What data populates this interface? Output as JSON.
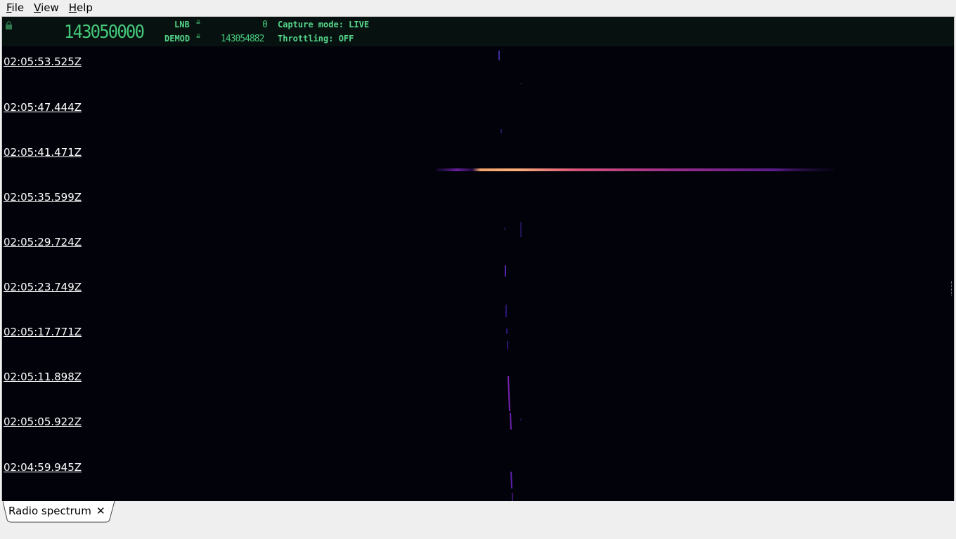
{
  "menubar": {
    "file": {
      "mnemonic": "F",
      "rest": "ile"
    },
    "view": {
      "mnemonic": "V",
      "rest": "iew"
    },
    "help": {
      "mnemonic": "H",
      "rest": "elp"
    }
  },
  "status": {
    "center_frequency": "143050000",
    "lnb_label": "LNB",
    "lnb_value": "0",
    "demod_label": "DEMOD",
    "demod_value": "143054882",
    "capture_mode": "Capture mode: LIVE",
    "throttling": "Throttling: OFF",
    "text_color": "#4ecf80",
    "background_color": "#061110"
  },
  "waterfall": {
    "colormap": "magma",
    "background_color": "#02030a",
    "timestamps": [
      "02:05:53.525Z",
      "02:05:47.444Z",
      "02:05:41.471Z",
      "02:05:35.599Z",
      "02:05:29.724Z",
      "02:05:23.749Z",
      "02:05:17.771Z",
      "02:05:11.898Z",
      "02:05:05.922Z",
      "02:04:59.945Z"
    ]
  },
  "tabs": [
    {
      "label": "Radio spectrum",
      "close_icon": "close-icon"
    }
  ]
}
